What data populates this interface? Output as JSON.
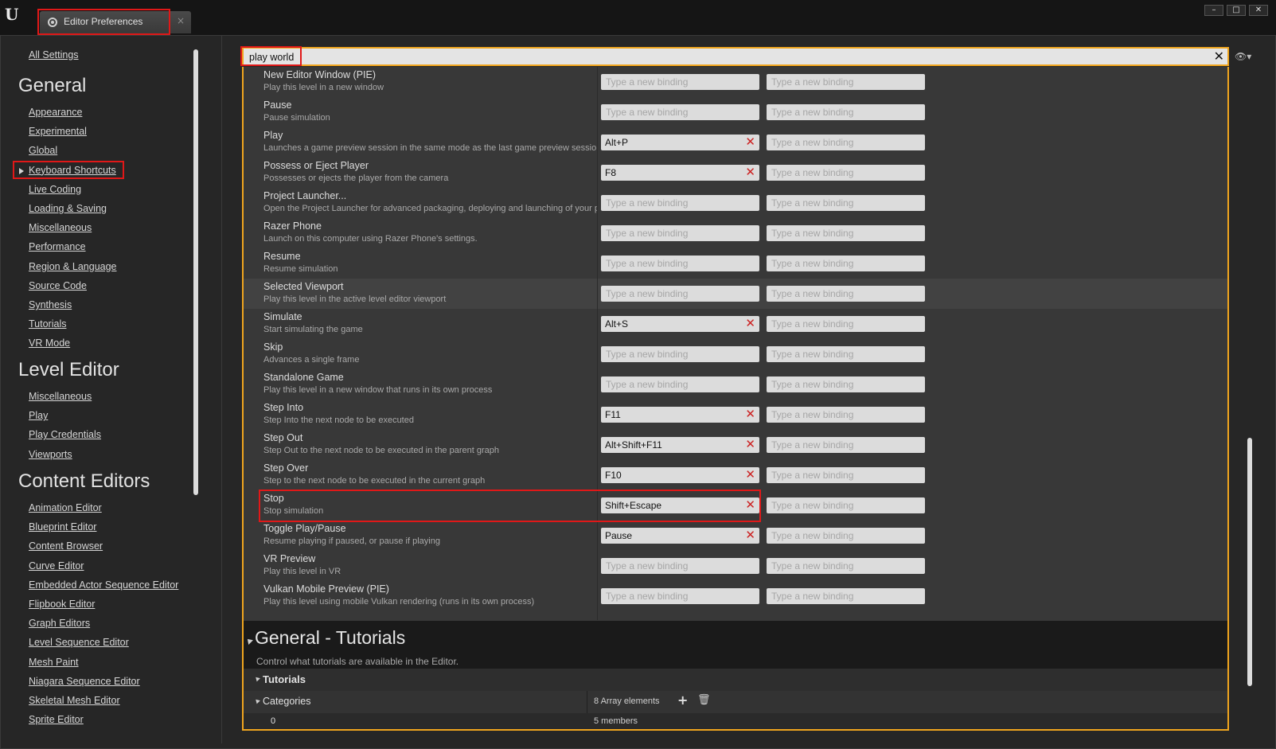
{
  "window": {
    "tab_title": "Editor Preferences",
    "tab_close": "×",
    "min": "–",
    "max": "□",
    "close": "✕"
  },
  "sidebar": {
    "all_settings": "All Settings",
    "sections": [
      {
        "heading": "General",
        "items": [
          "Appearance",
          "Experimental",
          "Global",
          "Keyboard Shortcuts",
          "Live Coding",
          "Loading & Saving",
          "Miscellaneous",
          "Performance",
          "Region & Language",
          "Source Code",
          "Synthesis",
          "Tutorials",
          "VR Mode"
        ]
      },
      {
        "heading": "Level Editor",
        "items": [
          "Miscellaneous",
          "Play",
          "Play Credentials",
          "Viewports"
        ]
      },
      {
        "heading": "Content Editors",
        "items": [
          "Animation Editor",
          "Blueprint Editor",
          "Content Browser",
          "Curve Editor",
          "Embedded Actor Sequence Editor",
          "Flipbook Editor",
          "Graph Editors",
          "Level Sequence Editor",
          "Mesh Paint",
          "Niagara Sequence Editor",
          "Skeletal Mesh Editor",
          "Sprite Editor"
        ]
      }
    ],
    "selected_item": "Keyboard Shortcuts"
  },
  "search": {
    "value": "play world"
  },
  "binding_placeholder": "Type a new binding",
  "commands": [
    {
      "name": "New Editor Window (PIE)",
      "desc": "Play this level in a new window",
      "binding": ""
    },
    {
      "name": "Pause",
      "desc": "Pause simulation",
      "binding": ""
    },
    {
      "name": "Play",
      "desc": "Launches a game preview session in the same mode as the last game preview session launched",
      "binding": "Alt+P"
    },
    {
      "name": "Possess or Eject Player",
      "desc": "Possesses or ejects the player from the camera",
      "binding": "F8"
    },
    {
      "name": "Project Launcher...",
      "desc": "Open the Project Launcher for advanced packaging, deploying and launching of your projects",
      "binding": ""
    },
    {
      "name": "Razer Phone",
      "desc": "Launch on this computer using Razer Phone's settings.",
      "binding": ""
    },
    {
      "name": "Resume",
      "desc": "Resume simulation",
      "binding": ""
    },
    {
      "name": "Selected Viewport",
      "desc": "Play this level in the active level editor viewport",
      "binding": ""
    },
    {
      "name": "Simulate",
      "desc": "Start simulating the game",
      "binding": "Alt+S"
    },
    {
      "name": "Skip",
      "desc": "Advances a single frame",
      "binding": ""
    },
    {
      "name": "Standalone Game",
      "desc": "Play this level in a new window that runs in its own process",
      "binding": ""
    },
    {
      "name": "Step Into",
      "desc": "Step Into the next node to be executed",
      "binding": "F11"
    },
    {
      "name": "Step Out",
      "desc": "Step Out to the next node to be executed in the parent graph",
      "binding": "Alt+Shift+F11"
    },
    {
      "name": "Step Over",
      "desc": "Step to the next node to be executed in the current graph",
      "binding": "F10"
    },
    {
      "name": "Stop",
      "desc": "Stop simulation",
      "binding": "Shift+Escape"
    },
    {
      "name": "Toggle Play/Pause",
      "desc": "Resume playing if paused, or pause if playing",
      "binding": "Pause"
    },
    {
      "name": "VR Preview",
      "desc": "Play this level in VR",
      "binding": ""
    },
    {
      "name": "Vulkan Mobile Preview (PIE)",
      "desc": "Play this level using mobile Vulkan rendering (runs in its own process)",
      "binding": ""
    }
  ],
  "tutorials_section": {
    "title": "General - Tutorials",
    "desc": "Control what tutorials are available in the Editor.",
    "group": "Tutorials",
    "categories_label": "Categories",
    "categories_value": "8 Array elements",
    "first_index": "0",
    "first_value": "5 members"
  }
}
